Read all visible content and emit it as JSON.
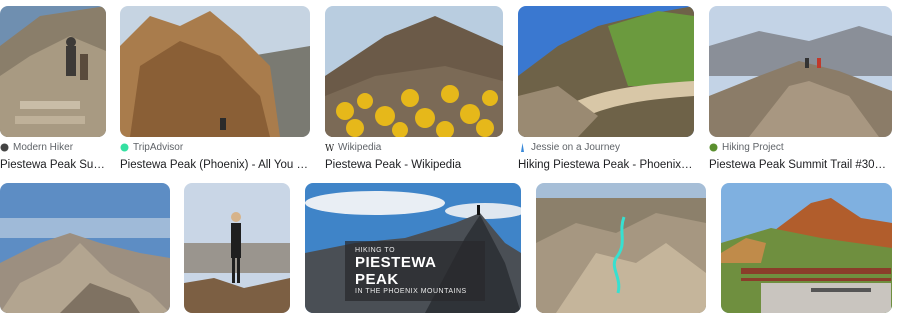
{
  "results": [
    {
      "source": "Modern Hiker",
      "favicon": "hiker-favicon-icon",
      "title": "Piestewa Peak Sum..."
    },
    {
      "source": "TripAdvisor",
      "favicon": "tripadvisor-favicon-icon",
      "title": "Piestewa Peak (Phoenix) - All You Nee..."
    },
    {
      "source": "Wikipedia",
      "favicon": "wikipedia-favicon-icon",
      "title": "Piestewa Peak - Wikipedia"
    },
    {
      "source": "Jessie on a Journey",
      "favicon": "journey-favicon-icon",
      "title": "Hiking Piestewa Peak - Phoenix Ariz..."
    },
    {
      "source": "Hiking Project",
      "favicon": "hiking-project-favicon-icon",
      "title": "Piestewa Peak Summit Trail #300 Hik..."
    }
  ],
  "row2_overlay": {
    "small_top": "HIKING TO",
    "big": "PIESTEWA PEAK",
    "small_bottom": "IN THE PHOENIX MOUNTAINS"
  },
  "colors": {
    "tripadvisor": "#34e0a1",
    "hiking_project": "#5a8f2e",
    "journey": "#3b8ad9"
  }
}
